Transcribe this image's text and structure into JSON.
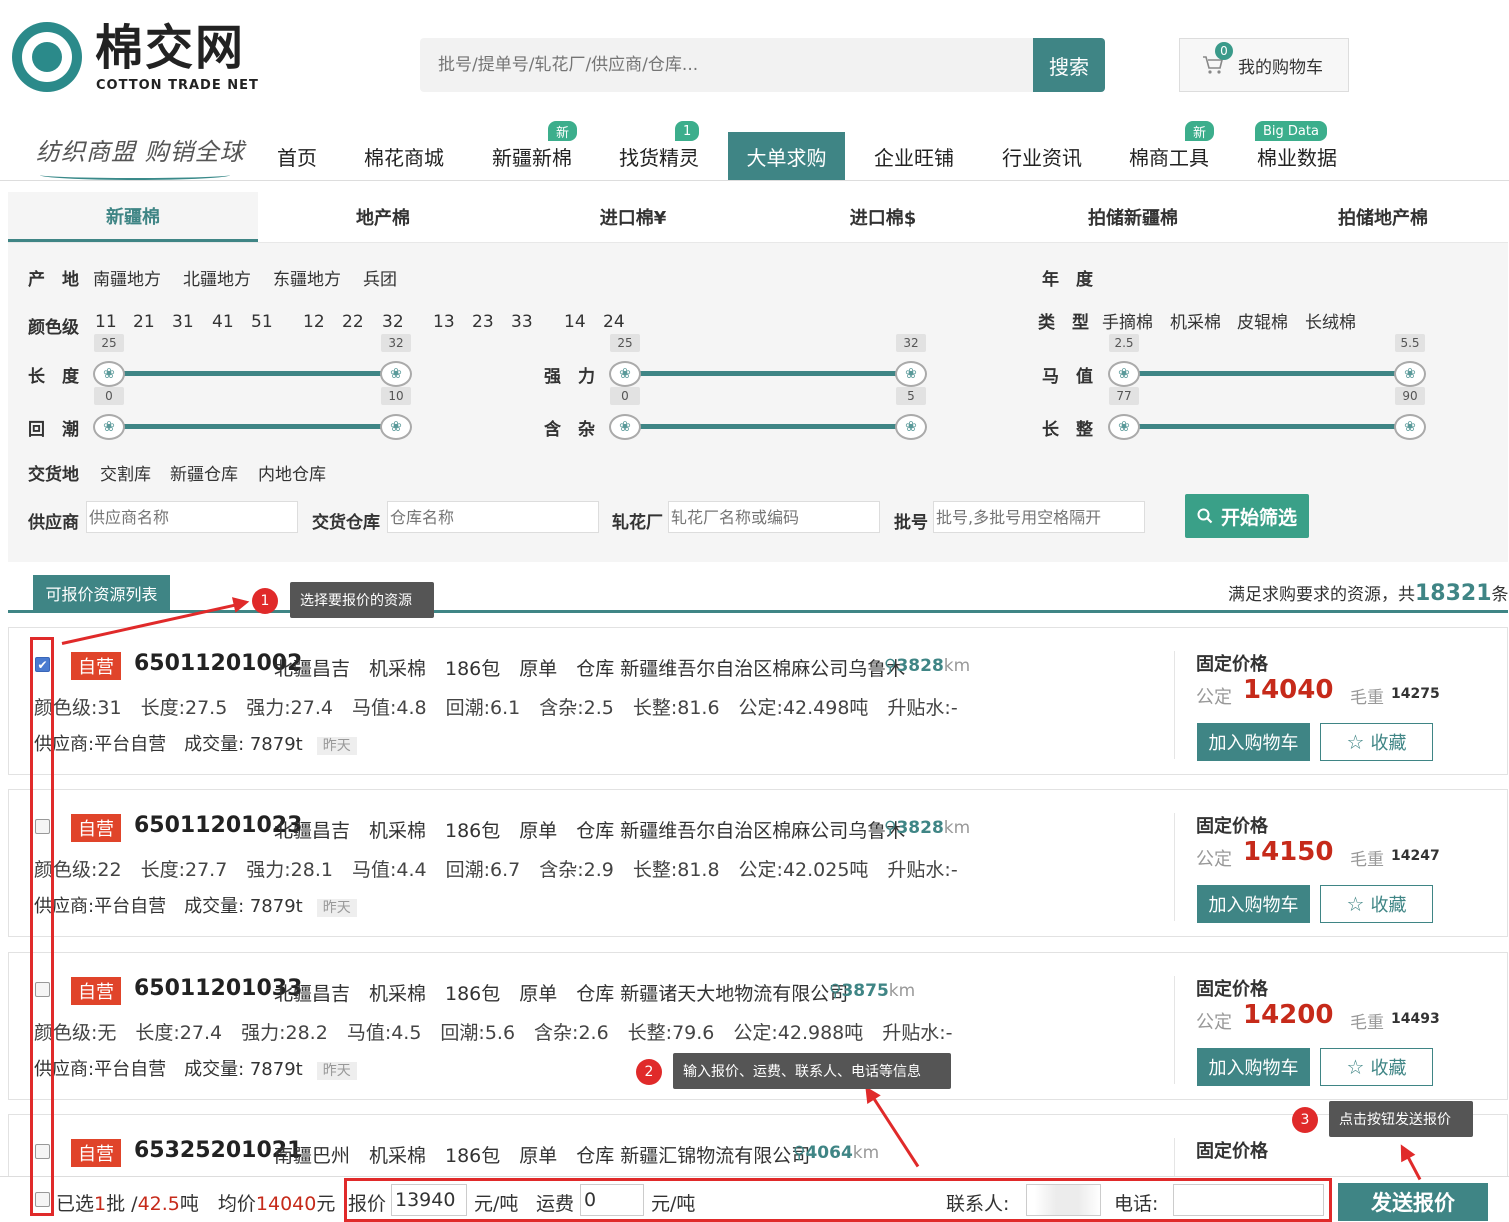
{
  "header": {
    "logo_title": "棉交网",
    "logo_subtitle": "COTTON TRADE NET",
    "search_placeholder": "批号/提单号/轧花厂/供应商/仓库...",
    "search_btn": "搜索",
    "cart_label": "我的购物车",
    "cart_count": "0",
    "slogan": "纺织商盟 购销全球"
  },
  "nav": [
    {
      "label": "首页"
    },
    {
      "label": "棉花商城"
    },
    {
      "label": "新疆新棉",
      "badge": "新"
    },
    {
      "label": "找货精灵",
      "badge": "1"
    },
    {
      "label": "大单求购",
      "active": true
    },
    {
      "label": "企业旺铺"
    },
    {
      "label": "行业资讯"
    },
    {
      "label": "棉商工具",
      "badge": "新"
    },
    {
      "label": "棉业数据",
      "badge": "Big Data"
    }
  ],
  "tabs": [
    "新疆棉",
    "地产棉",
    "进口棉¥",
    "进口棉$",
    "拍储新疆棉",
    "拍储地产棉"
  ],
  "filters": {
    "origin_label": "产　地",
    "origin_options": [
      "南疆地方",
      "北疆地方",
      "东疆地方",
      "兵团"
    ],
    "year_label": "年　度",
    "color_label": "颜色级",
    "color_options": [
      "11",
      "21",
      "31",
      "41",
      "51",
      "12",
      "22",
      "32",
      "13",
      "23",
      "33",
      "14",
      "24"
    ],
    "type_label": "类　型",
    "type_options": [
      "手摘棉",
      "机采棉",
      "皮辊棉",
      "长绒棉"
    ],
    "sliders": [
      {
        "label": "长　度",
        "min": "25",
        "max": "32"
      },
      {
        "label": "强　力",
        "min": "25",
        "max": "32"
      },
      {
        "label": "马　值",
        "min": "2.5",
        "max": "5.5"
      },
      {
        "label": "回　潮",
        "min": "0",
        "max": "10"
      },
      {
        "label": "含　杂",
        "min": "0",
        "max": "5"
      },
      {
        "label": "长　整",
        "min": "77",
        "max": "90"
      }
    ],
    "delivery_label": "交货地",
    "delivery_options": [
      "交割库",
      "新疆仓库",
      "内地仓库"
    ],
    "supplier_label": "供应商",
    "supplier_placeholder": "供应商名称",
    "warehouse_label": "交货仓库",
    "warehouse_placeholder": "仓库名称",
    "gin_label": "轧花厂",
    "gin_placeholder": "轧花厂名称或编码",
    "batch_label": "批号",
    "batch_placeholder": "批号,多批号用空格隔开",
    "filter_btn": "开始筛选"
  },
  "list": {
    "tab_label": "可报价资源列表",
    "count_prefix": "满足求购要求的资源，共",
    "count": "18321",
    "count_suffix": "条"
  },
  "cards": [
    {
      "checked": true,
      "tag": "自营",
      "batch": "65011201002",
      "line1": "北疆昌吉　机采棉　186包　原单　仓库 新疆维吾尔自治区棉麻公司乌鲁木",
      "dist": "3828",
      "dist_unit": "km",
      "line2": "颜色级:31　长度:27.5　强力:27.4　马值:4.8　回潮:6.1　含杂:2.5　长整:81.6　公定:42.498吨　升贴水:-",
      "line3": "供应商:平台自营　成交量: 7879t",
      "when": "昨天",
      "price_title": "固定价格",
      "price_label": "公定",
      "price": "14040",
      "weight_label": "毛重",
      "weight": "14275",
      "cart_btn": "加入购物车",
      "fav_btn": "收藏"
    },
    {
      "checked": false,
      "tag": "自营",
      "batch": "65011201023",
      "line1": "北疆昌吉　机采棉　186包　原单　仓库 新疆维吾尔自治区棉麻公司乌鲁木",
      "dist": "3828",
      "dist_unit": "km",
      "line2": "颜色级:22　长度:27.7　强力:28.1　马值:4.4　回潮:6.7　含杂:2.9　长整:81.8　公定:42.025吨　升贴水:-",
      "line3": "供应商:平台自营　成交量: 7879t",
      "when": "昨天",
      "price_title": "固定价格",
      "price_label": "公定",
      "price": "14150",
      "weight_label": "毛重",
      "weight": "14247",
      "cart_btn": "加入购物车",
      "fav_btn": "收藏"
    },
    {
      "checked": false,
      "tag": "自营",
      "batch": "65011201033",
      "line1": "北疆昌吉　机采棉　186包　原单　仓库 新疆诸天大地物流有限公司",
      "dist": "3875",
      "dist_unit": "km",
      "line2": "颜色级:无　长度:27.4　强力:28.2　马值:4.5　回潮:5.6　含杂:2.6　长整:79.6　公定:42.988吨　升贴水:-",
      "line3": "供应商:平台自营　成交量: 7879t",
      "when": "昨天",
      "price_title": "固定价格",
      "price_label": "公定",
      "price": "14200",
      "weight_label": "毛重",
      "weight": "14493",
      "cart_btn": "加入购物车",
      "fav_btn": "收藏"
    },
    {
      "checked": false,
      "tag": "自营",
      "batch": "65325201021",
      "line1": "南疆巴州　机采棉　186包　原单　仓库 新疆汇锦物流有限公司",
      "dist": "4064",
      "dist_unit": "km",
      "price_title": "固定价格"
    }
  ],
  "bottom": {
    "selected_prefix": "已选",
    "selected_count": "1",
    "selected_mid": "批 /",
    "selected_weight": "42.5",
    "selected_unit": "吨",
    "avg_prefix": "均价",
    "avg_price": "14040",
    "avg_unit": "元",
    "quote_label": "报价",
    "quote_value": "13940",
    "unit1": "元/吨",
    "freight_label": "运费",
    "freight_value": "0",
    "unit2": "元/吨",
    "contact_label": "联系人:",
    "phone_label": "电话:",
    "send_btn": "发送报价"
  },
  "annotations": [
    {
      "num": "1",
      "text": "选择要报价的资源"
    },
    {
      "num": "2",
      "text": "输入报价、运费、联系人、电话等信息"
    },
    {
      "num": "3",
      "text": "点击按钮发送报价"
    }
  ],
  "colors": {
    "brand": "#3f8585",
    "price_red": "#c62a1a",
    "self_tag": "#e0442a",
    "annotation": "#e02a2a"
  }
}
